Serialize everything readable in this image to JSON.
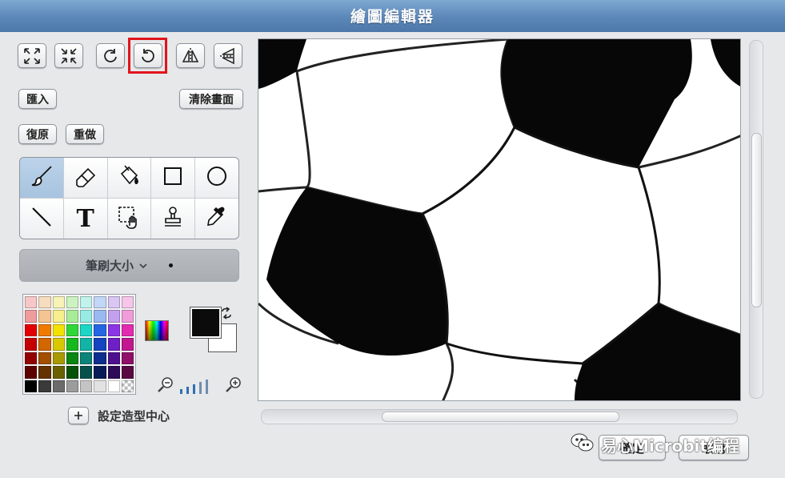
{
  "window": {
    "title": "繪圖編輯器"
  },
  "toolbar": {
    "top_icons": [
      "enlarge-icon",
      "shrink-icon",
      "rotate-counterclockwise-icon",
      "rotate-clockwise-icon",
      "flip-horizontal-icon",
      "flip-vertical-icon"
    ],
    "highlighted": "rotate-clockwise-icon",
    "import_label": "匯入",
    "clear_label": "清除畫面",
    "undo_label": "復原",
    "redo_label": "重做"
  },
  "tools": [
    {
      "name": "paintbrush-tool",
      "icon": "paintbrush-icon",
      "active": true
    },
    {
      "name": "eraser-tool",
      "icon": "eraser-icon"
    },
    {
      "name": "fill-tool",
      "icon": "paint-bucket-icon"
    },
    {
      "name": "rectangle-tool",
      "icon": "rectangle-icon"
    },
    {
      "name": "ellipse-tool",
      "icon": "ellipse-icon"
    },
    {
      "name": "line-tool",
      "icon": "line-icon"
    },
    {
      "name": "text-tool",
      "icon": "text-icon",
      "glyph": "T"
    },
    {
      "name": "select-tool",
      "icon": "select-hand-icon"
    },
    {
      "name": "stamp-tool",
      "icon": "stamp-icon"
    },
    {
      "name": "eyedropper-tool",
      "icon": "eyedropper-icon"
    }
  ],
  "brush": {
    "label": "筆刷大小"
  },
  "palette": {
    "colors": [
      "#f7c7c7",
      "#f7dcc0",
      "#f7f2b6",
      "#cdf2c1",
      "#c1f2ec",
      "#c2d6f7",
      "#dac6f4",
      "#f6c6ea",
      "#f09c9c",
      "#f4c493",
      "#f6ef8c",
      "#a9ec98",
      "#98ebe3",
      "#9ab9f1",
      "#c3a0ee",
      "#f09cdb",
      "#e30000",
      "#f07a00",
      "#f2e200",
      "#2fd838",
      "#1cd6c6",
      "#2566e3",
      "#8c35e6",
      "#e32bb0",
      "#c40000",
      "#d26600",
      "#d8c800",
      "#17b71f",
      "#12b4a6",
      "#1545bf",
      "#6f1fc6",
      "#c2178f",
      "#930000",
      "#a24f00",
      "#a89a00",
      "#0b8612",
      "#0a8479",
      "#0d2f8d",
      "#4d1190",
      "#900f69",
      "#5c0000",
      "#663100",
      "#6a6100",
      "#065209",
      "#06524b",
      "#081d58",
      "#2f0a59",
      "#5a0942",
      "#000000",
      "#3a3a3a",
      "#6b6b6b",
      "#9c9c9c",
      "#c4c4c4",
      "#e2e2e2",
      "#ffffff",
      "checker"
    ],
    "foreground": "#0b0b0b",
    "background": "#ffffff"
  },
  "zoom": {
    "levels": 5,
    "current": 2
  },
  "center": {
    "label": "設定造型中心"
  },
  "actions": {
    "ok_label": "確定",
    "cancel_label": "取消"
  },
  "watermark": {
    "text": "易心Microbit编程"
  }
}
